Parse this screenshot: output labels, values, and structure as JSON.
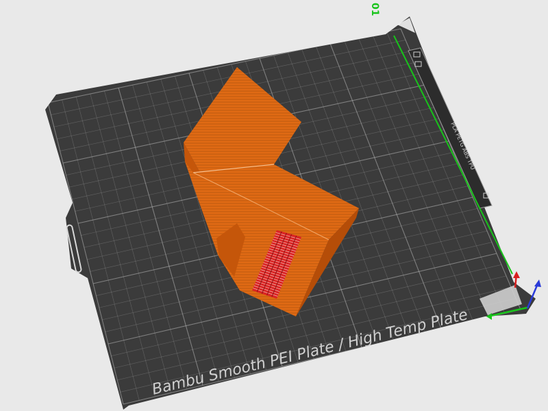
{
  "viewport": {
    "background_color": "#e9e9e9",
    "plate_number": "01",
    "plate_label": "Bambu Smooth PEI Plate / High Temp Plate",
    "side_label": "PLA PETG ABS TPU"
  },
  "plate": {
    "color": "#3b3b3b",
    "grid_color": "#b8b8b8"
  },
  "model": {
    "color": "#e06a14",
    "shade_color": "#c5560a",
    "dark_color": "#b54d08",
    "detail_color": "#d92424"
  },
  "axes": {
    "x_color": "#17c41a",
    "y_color": "#d81f1f",
    "z_color": "#2a3bd8"
  }
}
